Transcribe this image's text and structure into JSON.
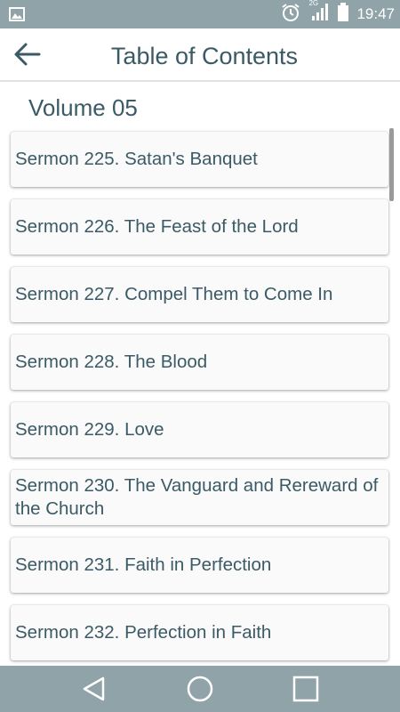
{
  "status_bar": {
    "time": "19:47",
    "network": "2G",
    "icons": [
      "gallery-icon",
      "alarm-icon",
      "signal-icon",
      "battery-icon"
    ]
  },
  "app_bar": {
    "title": "Table of Contents",
    "back_icon": "back-arrow-icon"
  },
  "volume": {
    "title": "Volume 05"
  },
  "sermons": [
    {
      "label": "Sermon 225. Satan's Banquet"
    },
    {
      "label": "Sermon 226. The Feast of the Lord"
    },
    {
      "label": "Sermon 227. Compel Them to Come In"
    },
    {
      "label": "Sermon 228. The Blood"
    },
    {
      "label": "Sermon 229. Love"
    },
    {
      "label": "Sermon 230. The Vanguard and Rereward of the Church"
    },
    {
      "label": "Sermon 231. Faith in Perfection"
    },
    {
      "label": "Sermon 232. Perfection in Faith"
    }
  ],
  "nav_bar": {
    "buttons": [
      "back-triangle-icon",
      "home-circle-icon",
      "recents-square-icon"
    ]
  },
  "colors": {
    "system_bars": "#8fa3a8",
    "text": "#3a5a66",
    "card": "#fafafa"
  }
}
